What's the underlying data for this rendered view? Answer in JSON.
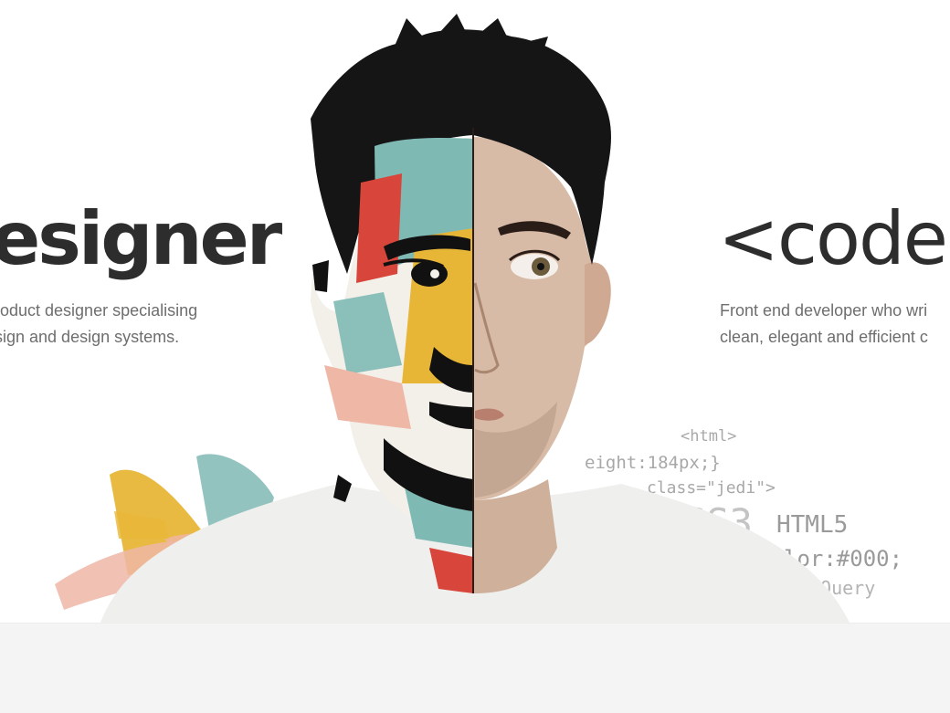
{
  "designer": {
    "title": "esigner",
    "description_line_1": "roduct designer specialising",
    "description_line_2": "sign and design systems."
  },
  "coder": {
    "title": "<coder",
    "description_line_1": "Front end developer who wri",
    "description_line_2": "clean, elegant and efficient c"
  },
  "code_snippets": [
    {
      "text": "<html>"
    },
    {
      "text": "eight:184px;}"
    },
    {
      "text": "class=\"jedi\">"
    },
    {
      "text": "SS3"
    },
    {
      "text": "HTML5"
    },
    {
      "text": "lor:#000;"
    },
    {
      "text": "jQuery"
    }
  ],
  "colors": {
    "title": "#2d2d2d",
    "description": "#6e6e6e",
    "code": "#a8a8a8",
    "paint_teal": "#7fb9b4",
    "paint_yellow": "#e8b637",
    "paint_red": "#d8453a",
    "paint_pink": "#efb7a6"
  }
}
